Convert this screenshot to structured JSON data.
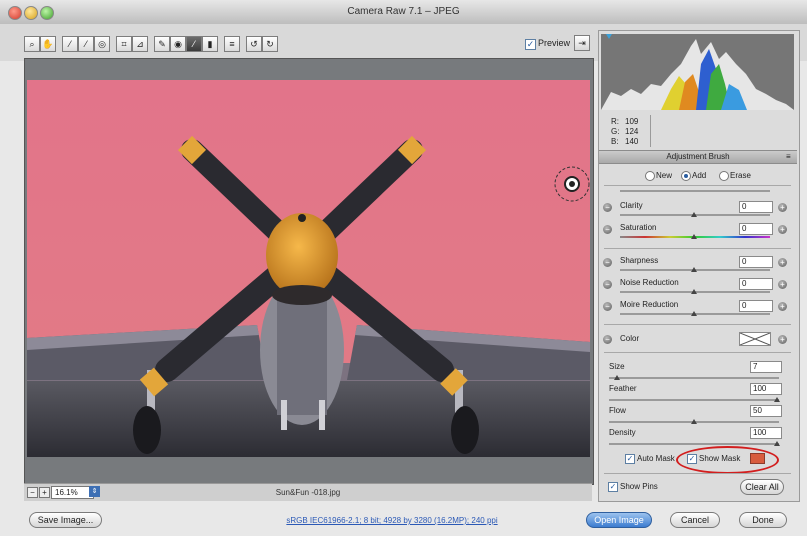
{
  "window": {
    "title": "Camera Raw 7.1  –  JPEG"
  },
  "toolbar": {
    "tools": [
      "zoom-icon",
      "hand-icon",
      "white-balance-icon",
      "color-sampler-icon",
      "target-adjust-icon",
      "crop-icon",
      "straighten-icon",
      "spot-removal-icon",
      "red-eye-icon",
      "adjustment-brush-icon",
      "graduated-filter-icon",
      "preferences-icon",
      "rotate-ccw-icon",
      "rotate-cw-icon"
    ],
    "preview_label": "Preview",
    "preview_checked": true
  },
  "image": {
    "filename": "Sun&Fun -018.jpg"
  },
  "zoom": {
    "value": "16.1%"
  },
  "histogram": {
    "r_label": "R:",
    "g_label": "G:",
    "b_label": "B:",
    "r": "109",
    "g": "124",
    "b": "140"
  },
  "panel": {
    "title": "Adjustment Brush",
    "modes": [
      {
        "label": "New",
        "selected": false
      },
      {
        "label": "Add",
        "selected": true
      },
      {
        "label": "Erase",
        "selected": false
      }
    ],
    "sliders": [
      {
        "label": "Clarity",
        "value": "0"
      },
      {
        "label": "Saturation",
        "value": "0"
      },
      {
        "label": "Sharpness",
        "value": "0"
      },
      {
        "label": "Noise Reduction",
        "value": "0"
      },
      {
        "label": "Moire Reduction",
        "value": "0"
      }
    ],
    "color_label": "Color",
    "brush": [
      {
        "label": "Size",
        "value": "7"
      },
      {
        "label": "Feather",
        "value": "100"
      },
      {
        "label": "Flow",
        "value": "50"
      },
      {
        "label": "Density",
        "value": "100"
      }
    ],
    "auto_mask_label": "Auto Mask",
    "show_mask_label": "Show Mask",
    "mask_color": "#d85c3e",
    "show_pins_label": "Show Pins",
    "clear_all_label": "Clear All"
  },
  "footer": {
    "save_label": "Save Image...",
    "workflow_link": "sRGB IEC61966-2.1; 8 bit; 4928 by 3280 (16.2MP); 240 ppi",
    "open_label": "Open Image",
    "cancel_label": "Cancel",
    "done_label": "Done"
  }
}
